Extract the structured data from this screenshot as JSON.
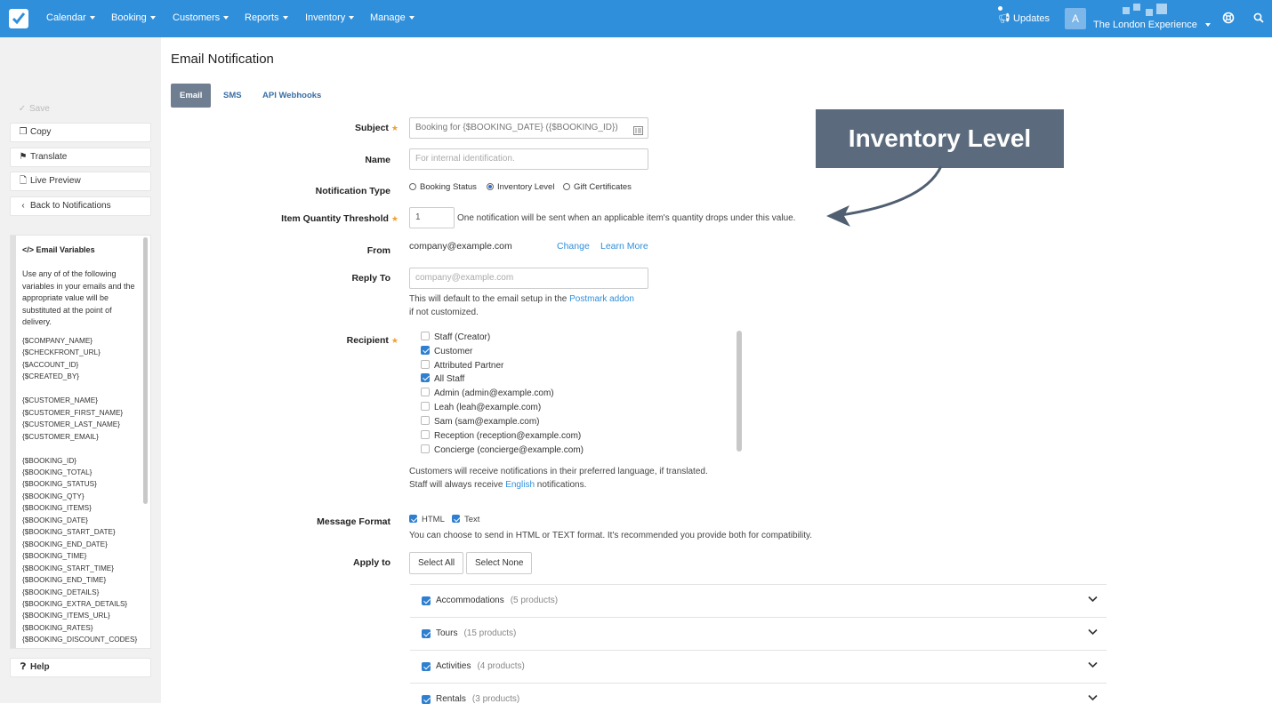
{
  "nav": {
    "items": [
      "Calendar",
      "Booking",
      "Customers",
      "Reports",
      "Inventory",
      "Manage"
    ],
    "updates": "Updates",
    "avatar": "A",
    "company": "The London Experience",
    "brand_color": "#2f8fdb"
  },
  "sidebar": {
    "save": "Save",
    "copy": "Copy",
    "translate": "Translate",
    "live_preview": "Live Preview",
    "back": "Back to Notifications",
    "vars_title": "Email Variables",
    "vars_desc": "Use any of of the following variables in your emails and the appropriate value will be substituted at the point of delivery.",
    "vars_list": "{$COMPANY_NAME}\n{$CHECKFRONT_URL}\n{$ACCOUNT_ID}\n{$CREATED_BY}\n\n{$CUSTOMER_NAME}\n{$CUSTOMER_FIRST_NAME}\n{$CUSTOMER_LAST_NAME}\n{$CUSTOMER_EMAIL}\n\n{$BOOKING_ID}\n{$BOOKING_TOTAL}\n{$BOOKING_STATUS}\n{$BOOKING_QTY}\n{$BOOKING_ITEMS}\n{$BOOKING_DATE}\n{$BOOKING_START_DATE}\n{$BOOKING_END_DATE}\n{$BOOKING_TIME}\n{$BOOKING_START_TIME}\n{$BOOKING_END_TIME}\n{$BOOKING_DETAILS}\n{$BOOKING_EXTRA_DETAILS}\n{$BOOKING_ITEMS_URL}\n{$BOOKING_RATES}\n{$BOOKING_DISCOUNT_CODES}",
    "help": "Help"
  },
  "page": {
    "title": "Email Notification",
    "tabs": [
      "Email",
      "SMS",
      "API Webhooks"
    ]
  },
  "form": {
    "subject_label": "Subject",
    "subject_value": "Booking for {$BOOKING_DATE} ({$BOOKING_ID})",
    "name_label": "Name",
    "name_placeholder": "For internal identification.",
    "type_label": "Notification Type",
    "type_options": [
      "Booking Status",
      "Inventory Level",
      "Gift Certificates"
    ],
    "type_selected": "Inventory Level",
    "threshold_label": "Item Quantity Threshold",
    "threshold_value": "1",
    "threshold_help": "One notification will be sent when an applicable item's quantity drops under this value.",
    "from_label": "From",
    "from_value": "company@example.com",
    "from_change": "Change",
    "from_learn": "Learn More",
    "reply_label": "Reply To",
    "reply_placeholder": "company@example.com",
    "reply_help_1": "This will default to the email setup in the",
    "reply_help_link": "Postmark addon",
    "reply_help_2": "if not customized.",
    "recipient_label": "Recipient",
    "recipients": [
      {
        "label": "Staff (Creator)",
        "checked": false
      },
      {
        "label": "Customer",
        "checked": true
      },
      {
        "label": "Attributed Partner",
        "checked": false
      },
      {
        "label": "All Staff",
        "checked": true
      },
      {
        "label": "Admin (admin@example.com)",
        "checked": false
      },
      {
        "label": "Leah (leah@example.com)",
        "checked": false
      },
      {
        "label": "Sam (sam@example.com)",
        "checked": false
      },
      {
        "label": "Reception (reception@example.com)",
        "checked": false
      },
      {
        "label": "Concierge (concierge@example.com)",
        "checked": false
      }
    ],
    "lang_note_1": "Customers will receive notifications in their preferred language, if translated.",
    "lang_note_2a": "Staff will always receive",
    "lang_note_link": "English",
    "lang_note_2b": "notifications.",
    "format_label": "Message Format",
    "format_html": "HTML",
    "format_text": "Text",
    "format_help": "You can choose to send in HTML or TEXT format. It's recommended you provide both for compatibility.",
    "apply_label": "Apply to",
    "select_all": "Select All",
    "select_none": "Select None",
    "categories": [
      {
        "name": "Accommodations",
        "count": "(5 products)"
      },
      {
        "name": "Tours",
        "count": "(15 products)"
      },
      {
        "name": "Activities",
        "count": "(4 products)"
      },
      {
        "name": "Rentals",
        "count": "(3 products)"
      }
    ]
  },
  "annotation": {
    "text": "Inventory Level",
    "color": "#5b6b7d"
  }
}
